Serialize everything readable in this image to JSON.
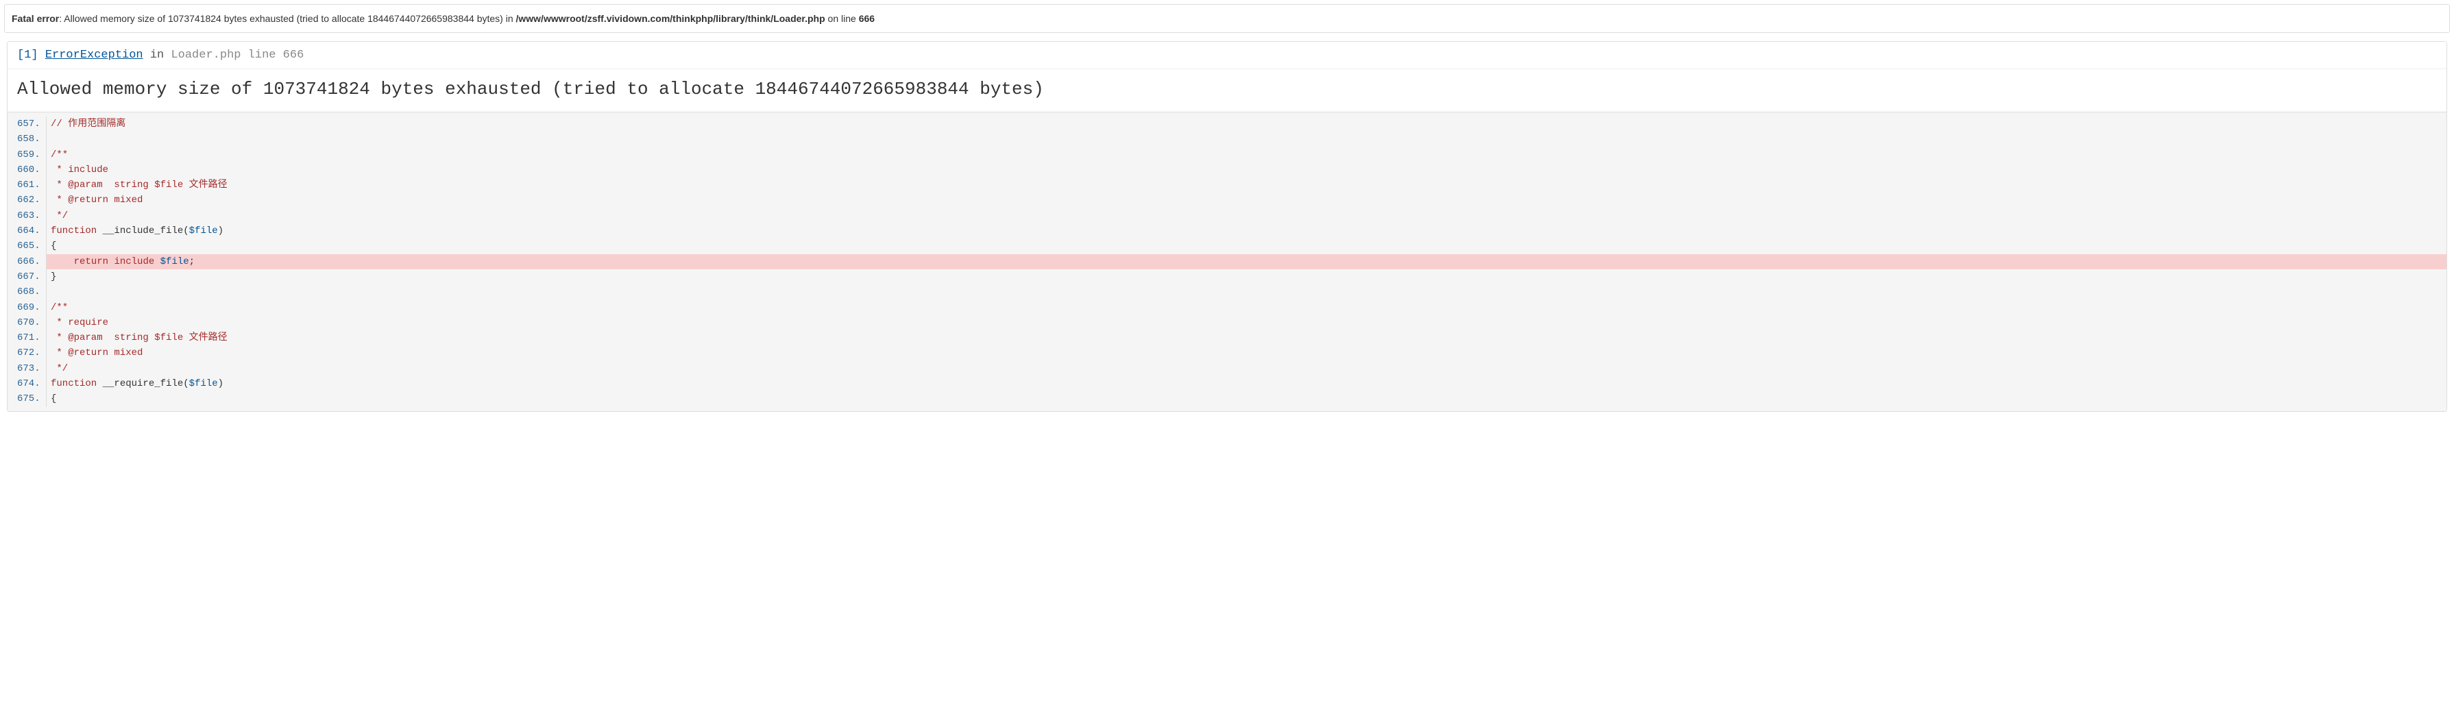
{
  "header": {
    "fatal_label": "Fatal error",
    "separator": ": ",
    "message": "Allowed memory size of 1073741824 bytes exhausted (tried to allocate 18446744072665983844 bytes) in ",
    "path": "/www/wwwroot/zsff.vividown.com/thinkphp/library/think/Loader.php",
    "on_line": " on line ",
    "line": "666"
  },
  "exception": {
    "index": "[1]",
    "name": "ErrorException",
    "in": " in ",
    "location": "Loader.php line 666",
    "message": "Allowed memory size of 1073741824 bytes exhausted (tried to allocate 18446744072665983844 bytes)"
  },
  "code": {
    "start": 657,
    "highlight": 666,
    "lines": [
      {
        "n": 657,
        "html": "<span class='cmt'>// 作用范围隔离</span>"
      },
      {
        "n": 658,
        "html": ""
      },
      {
        "n": 659,
        "html": "<span class='doc'>/**</span>"
      },
      {
        "n": 660,
        "html": "<span class='doc'> * include</span>"
      },
      {
        "n": 661,
        "html": "<span class='doc'> * @param  string $file 文件路径</span>"
      },
      {
        "n": 662,
        "html": "<span class='doc'> * @return mixed</span>"
      },
      {
        "n": 663,
        "html": "<span class='doc'> */</span>"
      },
      {
        "n": 664,
        "html": "<span class='kw'>function</span> <span class='fn'>__include_file(</span><span class='var'>$file</span><span class='fn'>)</span>"
      },
      {
        "n": 665,
        "html": "{"
      },
      {
        "n": 666,
        "html": "    <span class='kw'>return</span> <span class='kw'>include</span> <span class='var'>$file</span>;"
      },
      {
        "n": 667,
        "html": "}"
      },
      {
        "n": 668,
        "html": ""
      },
      {
        "n": 669,
        "html": "<span class='doc'>/**</span>"
      },
      {
        "n": 670,
        "html": "<span class='doc'> * require</span>"
      },
      {
        "n": 671,
        "html": "<span class='doc'> * @param  string $file 文件路径</span>"
      },
      {
        "n": 672,
        "html": "<span class='doc'> * @return mixed</span>"
      },
      {
        "n": 673,
        "html": "<span class='doc'> */</span>"
      },
      {
        "n": 674,
        "html": "<span class='kw'>function</span> <span class='fn'>__require_file(</span><span class='var'>$file</span><span class='fn'>)</span>"
      },
      {
        "n": 675,
        "html": "{"
      }
    ]
  }
}
